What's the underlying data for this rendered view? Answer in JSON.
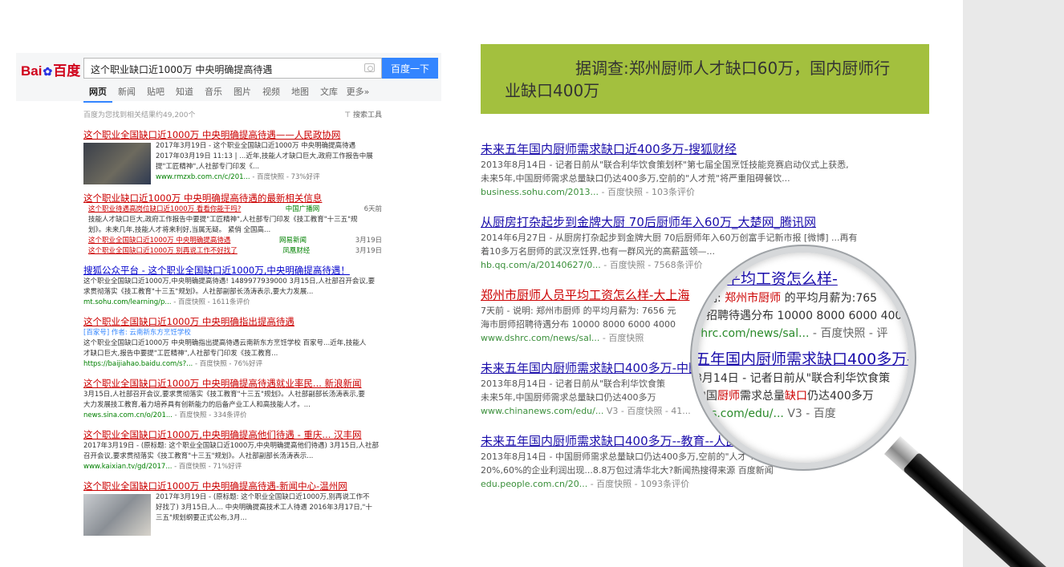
{
  "baidu": {
    "logo": "Bai百度",
    "query": "这个职业缺口近1000万 中央明确提高待遇",
    "search_button": "百度一下",
    "tabs": [
      "网页",
      "新闻",
      "贴吧",
      "知道",
      "音乐",
      "图片",
      "视频",
      "地图",
      "文库",
      "更多»"
    ],
    "result_count": "百度为您找到相关结果约49,200个",
    "tools": "搜索工具",
    "results": [
      {
        "title": "这个职业全国缺口近1000万 中央明确提高待遇——人民政协网",
        "line1": "2017年3月19日 - 这个职业全国缺口近1000万 中央明确提高待遇",
        "line2": "2017年03月19日 11:13 | ...近年,技能人才缺口巨大,政府工作报告中展",
        "line3": "提\"工匠精神\",人社部专门印发《...",
        "url": "www.rmzxb.com.cn/c/201...",
        "url_meta": "- 百度快照 - 73%好评"
      },
      {
        "title": "这个职业缺口近1000万 中央明确提高待遇的最新相关信息",
        "subs": [
          {
            "text": "这个职业待遇高岗位缺口近1000万 看看你能干吗?",
            "src": "中国广播网",
            "date": "6天前"
          },
          {
            "text": "技能人才缺口巨大,政府工作报告中要提\"工匠精神\",人社部专门印发《技工教育\"十三五\"规",
            "src": "",
            "date": ""
          },
          {
            "text": "划》。未来几年,技能人才将来利好,当属无疑。 紧俏 全国高...",
            "src": "",
            "date": ""
          },
          {
            "text": "这个职业全国缺口近1000万 中央明确提高待遇",
            "src": "网易新闻",
            "date": "3月19日"
          },
          {
            "text": "这个职业全国缺口近1000万 别再说工作不好找了",
            "src": "凤凰财经",
            "date": "3月19日"
          }
        ]
      },
      {
        "title": "搜狐公众平台 - 这个职业全国缺口近1000万,中央明确提高待遇！",
        "line1": "这个职业全国缺口近1000万,中央明确提高待遇! 1489977939000 3月15日,人社部召开会议,要",
        "line2": "求贯彻落实《技工教育\"十三五\"规划》。人社部副部长汤涛表示,要大力发展...",
        "url": "mt.sohu.com/learning/p...",
        "url_meta": "- 百度快照 - 1611条评价"
      },
      {
        "title": "这个职业全国缺口近1000万 中央明确指出提高待遇",
        "line1": "[百家号] 作者: 云南新东方烹饪学校",
        "line2": "这个职业全国缺口近1000万 中央明确指出提高待遇云南新东方烹饪学校 百家号...近年,技能人",
        "line3": "才缺口巨大,报告中要提\"工匠精神\",人社部专门印发《技工教育...",
        "url": "https://baijiahao.baidu.com/s?...",
        "url_meta": "- 百度快照 - 76%好评"
      },
      {
        "title": "这个职业全国缺口近1000万 中央明确提高待遇就业率民... 新浪新闻",
        "line1": "3月15日,人社部召开会议,要求贯彻落实《技工教育\"十三五\"规划》。人社部副部长汤涛表示,要",
        "line2": "大力发展技工教育,着力培养具有创新能力的后备产业工人和高技能人才。...",
        "url": "news.sina.com.cn/o/201...",
        "url_meta": "- 百度快照 - 334条评价"
      },
      {
        "title": "这个职业全国缺口近1000万,中央明确提高他们待遇 - 重庆... 汉丰网",
        "line1": "2017年3月19日 - (原标题: 这个职业全国缺口近1000万,中央明确提高他们待遇) 3月15日,人社部",
        "line2": "召开会议,要求贯彻落实《技工教育\"十三五\"规划》。人社部副部长汤涛表示...",
        "url": "www.kaixian.tv/gd/2017...",
        "url_meta": "- 百度快照 - 71%好评"
      },
      {
        "title": "这个职业全国缺口近1000万 中央明确提高待遇-新闻中心-温州网",
        "line1": "2017年3月19日 - (原标题: 这个职业全国缺口近1000万,别再说工作不",
        "line2": "好找了) 3月15日,人... 中央明确提高技术工人待遇 2016年3月17日,\"十",
        "line3": "三五\"规划纲要正式公布,3月..."
      }
    ]
  },
  "article": {
    "banner_text": "据调查:郑州厨师人才缺口60万，国内厨师行业缺口400万",
    "results": [
      {
        "title": "未来五年国内厨师需求缺口近400多万-搜狐财经",
        "desc1": "2013年8月14日 - 记者日前从\"联合利华饮食策划杯\"第七届全国烹饪技能竞赛启动仪式上获悉,",
        "desc2": "未来5年,中国厨师需求总量缺口仍达400多万,空前的\"人才荒\"将严重阻碍餐饮...",
        "url": "business.sohu.com/2013...",
        "meta": "- 百度快照 - 103条评价"
      },
      {
        "title": "从厨房打杂起步到金牌大厨 70后厨师年入60万_大楚网_腾讯网",
        "desc1": "2014年6月27日 - 从厨房打杂起步到金牌大厨 70后厨师年入60万创富手记新市报 [微博] ...再有",
        "desc2": "着10多万名厨师的武汉烹饪界,也有一群风光的高薪蓝领—...",
        "url": "hb.qq.com/a/20140627/0...",
        "meta": "- 百度快照 - 7568条评价"
      },
      {
        "title": "郑州市厨师人员平均工资怎么样-大上海",
        "desc1": "7天前 - 说明: 郑州市厨师 的平均月薪为: 7656 元",
        "desc2": "海市厨师招聘待遇分布 10000 8000 6000 4000",
        "url": "www.dshrc.com/news/sal...",
        "meta": "- 百度快照"
      },
      {
        "title": "未来五年国内厨师需求缺口400多万-中国新闻网",
        "desc1": "2013年8月14日 - 记者日前从\"联合利华饮食策",
        "desc2": "未来5年,中国厨师需求总量缺口仍达400多万",
        "url": "www.chinanews.com/edu/...",
        "meta": "V3 - 百度快照 - 41..."
      },
      {
        "title": "未来五年国内厨师需求缺口400多万--教育--人民网",
        "desc1": "2013年8月14日 - 中国厨师需求总量缺口仍达400多万,空前的\"人才\"...第二季度行业号榜前达",
        "desc2": "20%,60%的企业利润出现...8.8万包过清华北大?新闻热搜得来源 百度新闻",
        "url": "edu.people.com.cn/20...",
        "meta": "- 百度快照 - 1093条评价"
      }
    ],
    "magnifier": {
      "line1": "人员平均工资怎么样-",
      "line2a": "说明: ",
      "line2hl": "郑州市厨师",
      "line2b": " 的平均月薪为:765",
      "line3a": "师",
      "line3b": "招聘待遇分布 10000 8000 6000 400",
      "line4": "shrc.com/news/sal...",
      "line4meta": "- 百度快照 - 评",
      "line5": "五年国内厨师需求缺口400多万-中",
      "line6": "8月14日 - 记者日前从\"联合利华饮食策",
      "line7a": "中国",
      "line7hl": "厨师",
      "line7b": "需求总量",
      "line7hl2": "缺口",
      "line7c": "仍达400多万",
      "line8": "ews.com/edu/...",
      "line8meta": "V3 - 百度"
    }
  }
}
